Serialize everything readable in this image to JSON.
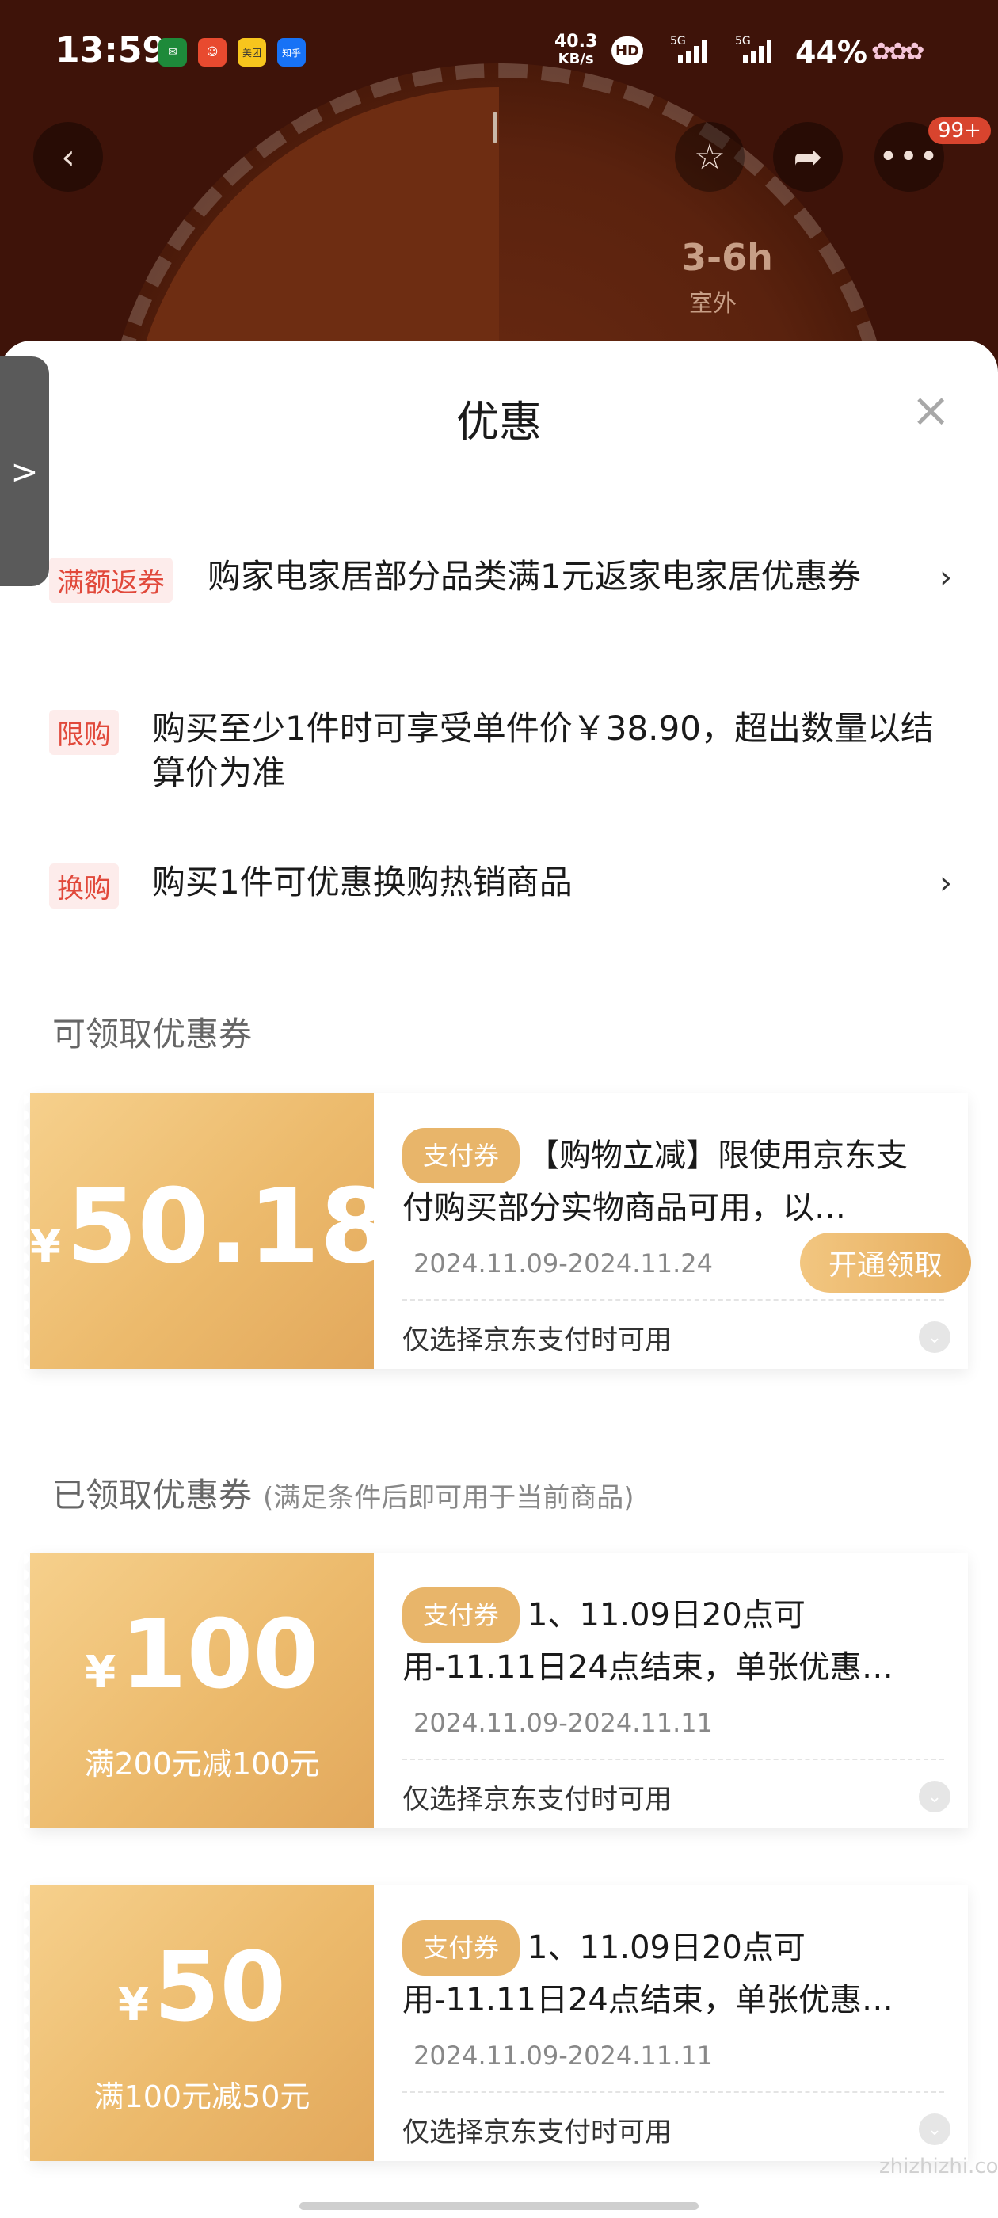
{
  "status_bar": {
    "time": "13:59",
    "net_speed_value": "40.3",
    "net_speed_unit": "KB/s",
    "hd": "HD",
    "signal1": "5G",
    "signal2": "5G",
    "battery": "44%",
    "app_icons": [
      "post-icon",
      "app-icon",
      "meituan-icon",
      "zhihu-icon"
    ],
    "meituan": "美团",
    "zhihu": "知乎"
  },
  "header": {
    "dial_main": "3-6h",
    "dial_sub": "室外",
    "badge": "99+"
  },
  "sheet": {
    "title": "优惠",
    "side_tab_icon": ">",
    "promos": [
      {
        "tag": "满额返券",
        "text": "购家电家居部分品类满1元返家电家居优惠券",
        "has_arrow": true
      },
      {
        "tag": "限购",
        "text": "购买至少1件时可享受单件价￥38.90，超出数量以结算价为准",
        "has_arrow": false
      },
      {
        "tag": "换购",
        "text": "购买1件可优惠换购热销商品",
        "has_arrow": true
      }
    ],
    "arrow": "›",
    "available_title": "可领取优惠券",
    "received_title": "已领取优惠券",
    "received_note": "(满足条件后即可用于当前商品)"
  },
  "coupons": [
    {
      "yen": "¥",
      "amount": "50.18",
      "sub": "",
      "tag": "支付券",
      "desc": "【购物立减】限使用京东支付购买部分实物商品可用，以…",
      "date": "2024.11.09-2024.11.24",
      "button": "开通领取",
      "condition": "仅选择京东支付时可用"
    },
    {
      "yen": "¥",
      "amount": "100",
      "sub": "满200元减100元",
      "tag": "支付券",
      "desc": "1、11.09日20点可用-11.11日24点结束，单张优惠…",
      "date": "2024.11.09-2024.11.11",
      "button": "",
      "condition": "仅选择京东支付时可用"
    },
    {
      "yen": "¥",
      "amount": "50",
      "sub": "满100元减50元",
      "tag": "支付券",
      "desc": "1、11.09日20点可用-11.11日24点结束，单张优惠…",
      "date": "2024.11.09-2024.11.11",
      "button": "",
      "condition": "仅选择京东支付时可用"
    }
  ],
  "watermark": "zhizhizhi.com",
  "colors": {
    "accent": "#e8b56a",
    "tag_red": "#e1493b",
    "header_bg": "#3e1309"
  }
}
